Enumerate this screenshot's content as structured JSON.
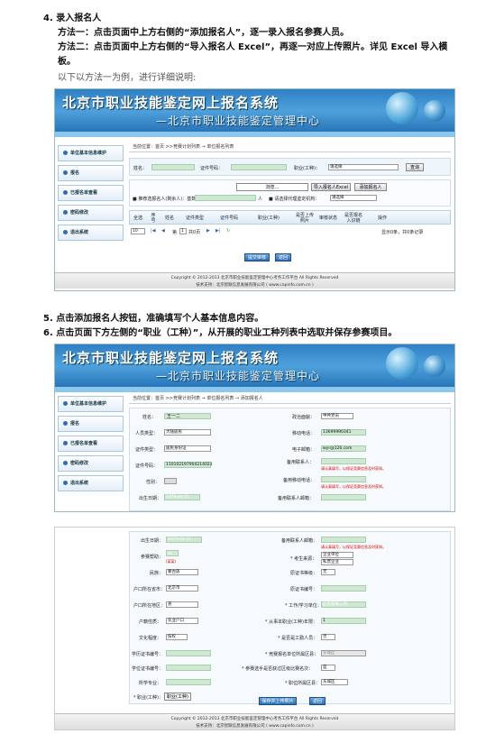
{
  "doc": {
    "step4_title": "4.   录入报名人",
    "method1": "方法一：点击页面中上方右侧的“添加报名人”，逐一录入报名参赛人员。",
    "method2a": "方法二：点击页面中上方右侧的“导入报名人 Excel”，再逐一对应上传照片。详见 Excel 导入模",
    "method2b": "板。",
    "note": "以下以方法一为例，进行详细说明:",
    "step5": "5.   点击添加报名人按钮，准确填写个人基本信息内容。",
    "step6": "6.   点击页面下方左侧的“职业（工种）”，从开展的职业工种列表中选取并保存参赛项目。"
  },
  "site": {
    "title": "北京市职业技能鉴定网上报名系统",
    "subtitle": "—北京市职业技能鉴定管理中心",
    "footer_copyright": "Copyright © 2012-2013 北京市职业技能鉴定管理中心考务工作平台 All Rights Reserved",
    "footer_support": "技术支持：北京智联信息发展有限公司 ( www.capinfo.com.cn )"
  },
  "sidebar": {
    "items": [
      "单位基本信息维护",
      "报名",
      "已报名单查看",
      "密码修改",
      "退出系统"
    ]
  },
  "shot1": {
    "crumb": "当前位置：首页 >>竞赛计划列表 → 单位报名列表",
    "name_label": "姓名：",
    "id_label": "证件号码：",
    "job_label": "职业(工种)：",
    "job_select": "请选择",
    "query_button": "查询",
    "browse_button": "浏览...",
    "import_button": "导入报名人Excel",
    "add_button": "添加报名人",
    "quota_text": "■ 推荐选报名人(剩余人)：基数：",
    "quota_unit": "人",
    "agency_label": "■ 请选择代理鉴定机构：",
    "agency_select": "请选择",
    "columns": [
      "全选",
      "序号",
      "姓名",
      "证件类型",
      "证件号码",
      "职业(工种)",
      "是否上传照片",
      "审核状态",
      "是否报名入识链",
      "操作"
    ],
    "page_size": "10",
    "page_text": "第",
    "page_num": "1",
    "page_total": "共0页",
    "record_info": "显示0条，共0条记录",
    "submit_button": "提交审核",
    "back_button": "返回"
  },
  "shot2": {
    "crumb": "当前位置：首页 >>竞赛计划列表 → 单位报名列表 → 添加报名人",
    "left_fields": [
      {
        "label": "姓名：",
        "value": "王一二",
        "type": "text"
      },
      {
        "label": "人员类型：",
        "value": "大陆居民",
        "type": "select"
      },
      {
        "label": "证件类型：",
        "value": "居民身份证",
        "type": "select"
      },
      {
        "label": "证件号码：",
        "value": "110102197904214023",
        "type": "text"
      },
      {
        "label": "性别：",
        "value": "",
        "type": "select"
      },
      {
        "label": "出生日期：",
        "value": "1979-04-21",
        "type": "text"
      }
    ],
    "right_fields": [
      {
        "label": "政治面貌：",
        "value": "中共党员",
        "type": "select"
      },
      {
        "label": "移动电话：",
        "value": "13699990341",
        "type": "text"
      },
      {
        "label": "电子邮箱：",
        "value": "wyr@126.com",
        "type": "text"
      },
      {
        "label": "备用联系人：",
        "value": "",
        "type": "text"
      },
      {
        "label": "备用移动电话：",
        "value": "",
        "type": "text"
      },
      {
        "label": "备用联系人邮箱：",
        "value": "",
        "type": "text"
      }
    ],
    "hint": "请认真填写，以保证竞赛信息及时获知。",
    "lower_left": [
      {
        "label": "出生日期：",
        "value": "1979-04-21"
      },
      {
        "label": "参赛帮助：",
        "value": "(如：)",
        "extra": "(某某)"
      },
      {
        "label": "民族：",
        "value": "蒙古族"
      },
      {
        "label": "户口所在省市：",
        "value": "北京市"
      },
      {
        "label": "户口所在地区：",
        "value": "县"
      },
      {
        "label": "户籍性质：",
        "value": "农业户口"
      },
      {
        "label": "文化程度：",
        "value": "技校"
      },
      {
        "label": "学历证书编号：",
        "value": ""
      },
      {
        "label": "学位证书编号：",
        "value": ""
      },
      {
        "label": "所学专业：",
        "value": ""
      }
    ],
    "lower_right": [
      {
        "label": "备用联系人邮箱：",
        "value": ""
      },
      {
        "label": "* 考生来源：",
        "value": "企业单位",
        "value2": "私营企业"
      },
      {
        "label": "原证书等级：",
        "value": "无"
      },
      {
        "label": "原证书编号：",
        "value": ""
      },
      {
        "label": "* 工作/学习单位：",
        "value": "北京某某公司"
      },
      {
        "label": "* 从事本职业(工种)年限：",
        "value": "1"
      },
      {
        "label": "* 是否是工勤人员：",
        "value": "否"
      },
      {
        "label": "* 竞赛报名单位所属区县：",
        "value": "东城区"
      },
      {
        "label": "* 参赛选手是否获过区级比赛名次：",
        "value": "是"
      },
      {
        "label": "* 职位所属区县：",
        "value": "东城区"
      }
    ],
    "job_label": "* 职业(工种)：",
    "job_button": "职业(工种)",
    "save_button": "保存并上传照片",
    "back_button": "返回"
  }
}
